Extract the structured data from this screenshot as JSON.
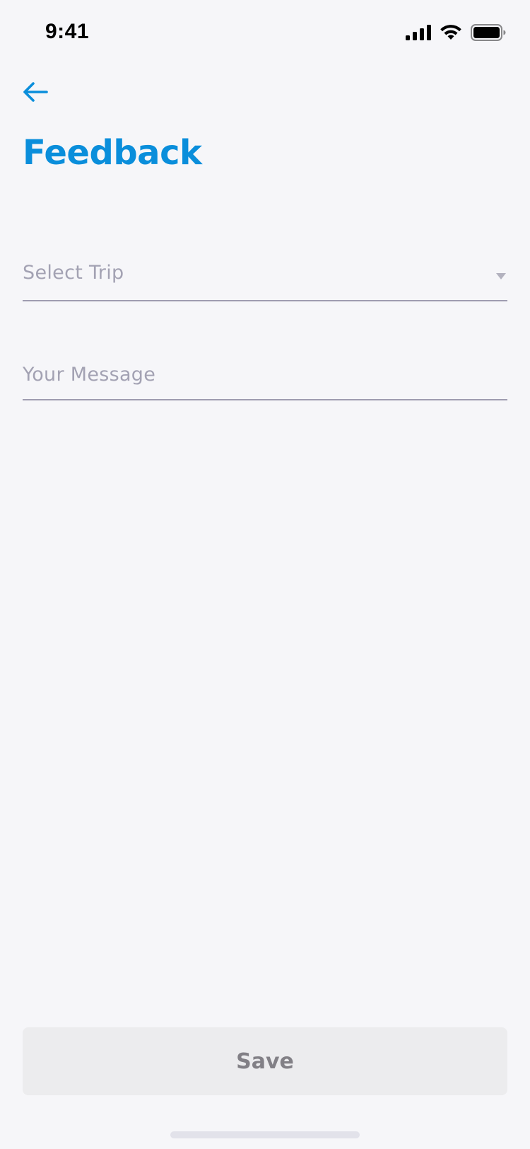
{
  "status_bar": {
    "time": "9:41"
  },
  "header": {
    "back_icon": "arrow-left-icon",
    "title": "Feedback"
  },
  "form": {
    "trip_select": {
      "placeholder": "Select Trip",
      "icon": "dropdown-triangle-icon"
    },
    "message": {
      "placeholder": "Your Message",
      "value": ""
    }
  },
  "footer": {
    "save_label": "Save"
  },
  "colors": {
    "accent": "#0a8edb",
    "background": "#f6f6f9",
    "placeholder": "#a3a2b3",
    "divider": "#9f9cb0",
    "button_bg": "#ececee",
    "button_text": "#828086"
  }
}
